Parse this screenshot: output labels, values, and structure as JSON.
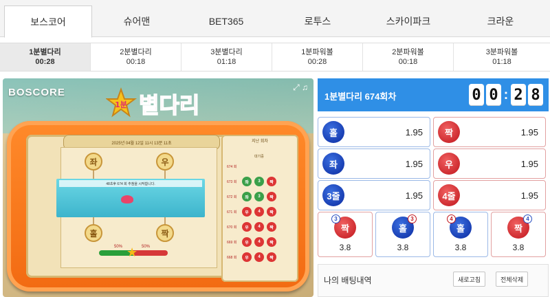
{
  "providers": [
    "보스코어",
    "슈어맨",
    "BET365",
    "로투스",
    "스카이파크",
    "크라운"
  ],
  "games": [
    {
      "title": "1분별다리",
      "time": "00:28"
    },
    {
      "title": "2분별다리",
      "time": "00:18"
    },
    {
      "title": "3분별다리",
      "time": "01:18"
    },
    {
      "title": "1분파워볼",
      "time": "00:28"
    },
    {
      "title": "2분파워볼",
      "time": "00:18"
    },
    {
      "title": "3분파워볼",
      "time": "01:18"
    }
  ],
  "game_screen": {
    "brand": "BOSCORE",
    "logo_number": "1분",
    "logo_text": "별다리",
    "date_line": "2025년 04월 12일    11시 13분 11초",
    "left_label": "좌",
    "right_label": "우",
    "odd_label": "홀",
    "even_label": "짝",
    "message": "48초후 674 회 추첨을 시작합니다.",
    "pct_left": "50%",
    "pct_right": "50%",
    "history_title": "지난 회차",
    "history_header": "대기중",
    "history": [
      {
        "round": "674 회",
        "balls": [
          "",
          "",
          ""
        ]
      },
      {
        "round": "673 회",
        "balls": [
          "좌",
          "3",
          "짝"
        ]
      },
      {
        "round": "672 회",
        "balls": [
          "좌",
          "3",
          "짝"
        ]
      },
      {
        "round": "671 회",
        "balls": [
          "우",
          "4",
          "짝"
        ]
      },
      {
        "round": "670 회",
        "balls": [
          "우",
          "4",
          "짝"
        ]
      },
      {
        "round": "669 회",
        "balls": [
          "우",
          "4",
          "짝"
        ]
      },
      {
        "round": "668 회",
        "balls": [
          "우",
          "4",
          "짝"
        ]
      }
    ]
  },
  "panel": {
    "title": "1분별다리 674회차",
    "countdown": [
      "0",
      "0",
      "2",
      "8"
    ],
    "bets": [
      {
        "label": "홀",
        "odds": "1.95",
        "color": "blue"
      },
      {
        "label": "짝",
        "odds": "1.95",
        "color": "red"
      },
      {
        "label": "좌",
        "odds": "1.95",
        "color": "blue"
      },
      {
        "label": "우",
        "odds": "1.95",
        "color": "red"
      },
      {
        "label": "3줄",
        "odds": "1.95",
        "color": "blue"
      },
      {
        "label": "4줄",
        "odds": "1.95",
        "color": "red"
      }
    ],
    "combos": [
      {
        "badge": "3",
        "label": "짝",
        "odds": "3.8",
        "chip": "red"
      },
      {
        "badge": "3",
        "label": "홀",
        "odds": "3.8",
        "chip": "blue"
      },
      {
        "badge": "4",
        "label": "홀",
        "odds": "3.8",
        "chip": "blue"
      },
      {
        "badge": "4",
        "label": "짝",
        "odds": "3.8",
        "chip": "red"
      }
    ],
    "my_bets_title": "나의 배팅내역",
    "refresh_label": "새로고침",
    "delete_all_label": "전체삭제"
  }
}
